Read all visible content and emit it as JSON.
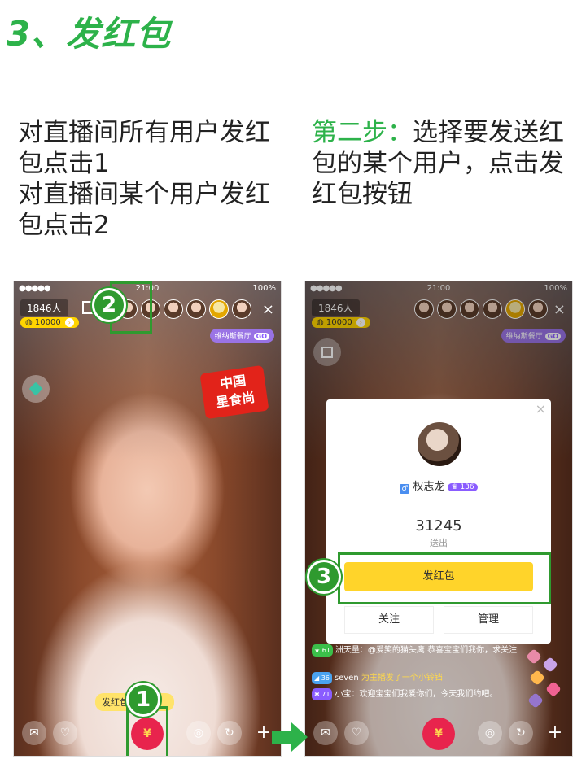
{
  "heading": "3、发红包",
  "left_desc": {
    "line1": "对直播间所有用户发红包点击1",
    "line2": "对直播间某个用户发红包点击2"
  },
  "right_desc": {
    "prefix": "第二步：",
    "text": "选择要发送红包的某个用户，点击发红包按钮"
  },
  "colors": {
    "accent_green": "#2db24a",
    "highlight_green": "#2f9a2f",
    "red_packet": "#e8244d",
    "button_yellow": "#ffd42a"
  },
  "phone_left": {
    "status": {
      "signal": "●●●●● ",
      "time": "21:00",
      "battery": "100%"
    },
    "viewer_count": "1846人",
    "coins": "10000",
    "coin_arrow": "›",
    "close": "×",
    "guild_tag": "维纳斯餐厅",
    "guild_go": "GO",
    "badge_logo": "中国\n星食尚",
    "hint": "发红包  粉丝吧！",
    "red_packet_symbol": "¥",
    "badges": {
      "one": "1",
      "two": "2"
    },
    "icons": [
      "mail-icon",
      "heart-icon",
      "camera-icon",
      "share-icon",
      "plus-icon"
    ]
  },
  "phone_right": {
    "status": {
      "signal": "●●●●● ",
      "time": "21:00",
      "battery": "100%"
    },
    "viewer_count": "1846人",
    "coins": "10000",
    "coin_arrow": "›",
    "close": "×",
    "guild_tag": "维纳斯餐厅",
    "guild_go": "GO",
    "popup": {
      "close": "×",
      "username": "权志龙",
      "gender_icon": "♂",
      "level": "136",
      "gift_count": "31245",
      "gift_label": "送出",
      "send_button": "发红包",
      "follow_button": "关注",
      "manage_button": "管理"
    },
    "badge_three": "3",
    "chat": [
      {
        "level": "61",
        "user": "洲天量",
        "text": "：@爱笑的猫头鹰 恭喜宝宝们我你，求关注"
      },
      {
        "level": "36",
        "user": "seven",
        "text": "为主播发了一个小铃铛"
      },
      {
        "level": "71",
        "user": "小宝",
        "text": "：欢迎宝宝们我爱你们，今天我们约吧。"
      }
    ],
    "red_packet_symbol": "¥",
    "bottom_side_badge": "3"
  }
}
